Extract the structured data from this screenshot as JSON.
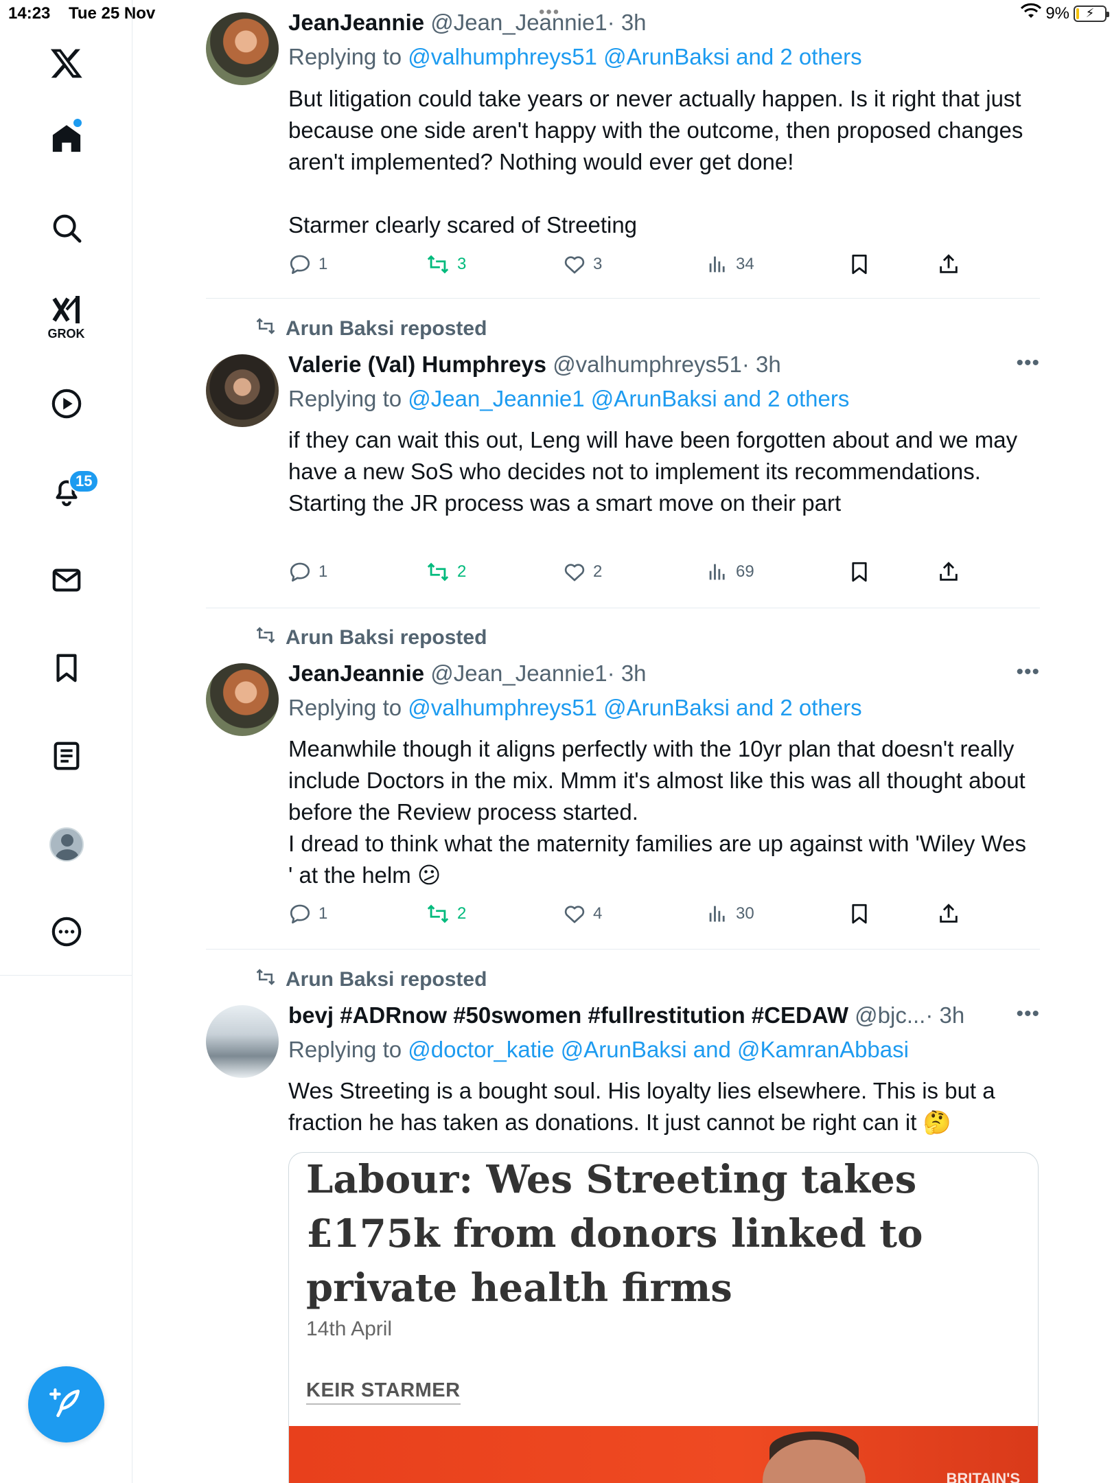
{
  "status_bar": {
    "time": "14:23",
    "date": "Tue 25 Nov",
    "battery": "9%",
    "battery_fraction": 0.09,
    "top_dots": "•••"
  },
  "sidebar": {
    "items": [
      {
        "name": "x-logo-icon"
      },
      {
        "name": "home-icon",
        "has_dot": true
      },
      {
        "name": "search-icon"
      },
      {
        "name": "grok-icon",
        "label": "GROK"
      },
      {
        "name": "video-icon"
      },
      {
        "name": "notifications-icon",
        "badge": "15"
      },
      {
        "name": "messages-icon"
      },
      {
        "name": "bookmarks-icon"
      },
      {
        "name": "lists-icon"
      },
      {
        "name": "profile-icon"
      },
      {
        "name": "more-icon"
      }
    ],
    "compose_icon": "compose-icon"
  },
  "colors": {
    "accent": "#1d9bf0",
    "retweet": "#00ba7c",
    "muted": "#536471",
    "text": "#0f1419"
  },
  "tweets": [
    {
      "name": "JeanJeannie",
      "handle": "@Jean_Jeannie1",
      "time": "· 3h",
      "reply_prefix": "Replying to",
      "reply_to": "@valhumphreys51 @ArunBaksi and 2 others",
      "body": [
        "But litigation could take years or never actually happen. Is it right that just because one side aren't happy with the outcome, then proposed changes aren't implemented? Nothing would ever get done!",
        "",
        "Starmer clearly scared of Streeting"
      ],
      "replies": "1",
      "retweets": "3",
      "likes": "3",
      "views": "34"
    },
    {
      "repost_label": "Arun Baksi reposted",
      "name": "Valerie (Val) Humphreys",
      "handle": "@valhumphreys51",
      "time": "· 3h",
      "reply_prefix": "Replying to",
      "reply_to": "@Jean_Jeannie1 @ArunBaksi and 2 others",
      "body": [
        "if they can wait this out, Leng will have been forgotten about and we may have a new SoS who decides not to implement its recommendations.",
        "Starting the JR process was a smart move on their part"
      ],
      "replies": "1",
      "retweets": "2",
      "likes": "2",
      "views": "69"
    },
    {
      "repost_label": "Arun Baksi reposted",
      "name": "JeanJeannie",
      "handle": "@Jean_Jeannie1",
      "time": "· 3h",
      "reply_prefix": "Replying to",
      "reply_to": "@valhumphreys51 @ArunBaksi and 2 others",
      "body": [
        "Meanwhile though it aligns perfectly with the 10yr plan that doesn't really include Doctors in the mix. Mmm it's almost like this was all thought about before the Review process started.",
        "I dread to think what the maternity families are up against with 'Wiley Wes ' at the helm 😕"
      ],
      "replies": "1",
      "retweets": "2",
      "likes": "4",
      "views": "30"
    },
    {
      "repost_label": "Arun Baksi reposted",
      "name": "bevj #ADRnow #50swomen #fullrestitution #CEDAW",
      "handle": "@bjc...",
      "time": "· 3h",
      "reply_prefix": "Replying to",
      "reply_to": "@doctor_katie @ArunBaksi and @KamranAbbasi",
      "body": [
        "Wes Streeting is a bought soul. His loyalty lies elsewhere. This is but a fraction he has taken as donations. It just cannot be right can it 🤔"
      ],
      "card": {
        "headline": "Labour: Wes Streeting takes £175k from donors linked to private health firms",
        "date": "14th April",
        "tag": "KEIR STARMER",
        "image_text": "BRITAIN'S"
      }
    }
  ],
  "more_label": "•••"
}
